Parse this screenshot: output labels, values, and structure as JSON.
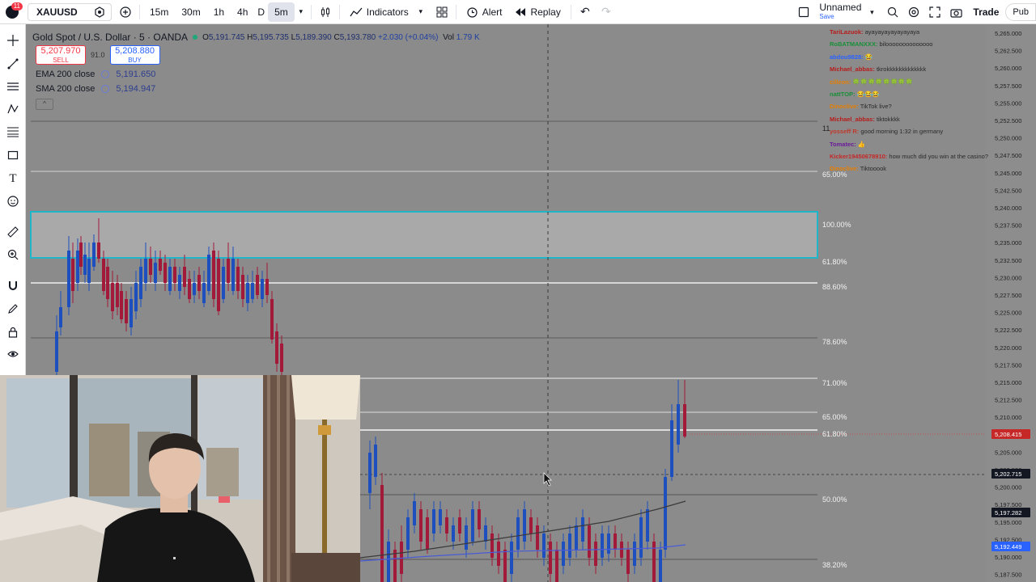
{
  "topbar": {
    "notification_count": "11",
    "symbol": "XAUUSD",
    "intervals": [
      "15m",
      "30m",
      "1h",
      "4h",
      "D",
      "5m"
    ],
    "active_interval": "5m",
    "indicators_label": "Indicators",
    "alert_label": "Alert",
    "replay_label": "Replay",
    "layout_name": "Unnamed",
    "save_label": "Save",
    "trade_label": "Trade",
    "publish_label": "Pub"
  },
  "legend": {
    "title": "Gold Spot / U.S. Dollar · 5 · OANDA",
    "open_label": "O",
    "open": "5,191.745",
    "high_label": "H",
    "high": "5,195.735",
    "low_label": "L",
    "low": "5,189.390",
    "close_label": "C",
    "close": "5,193.780",
    "change": "+2.030 (+0.04%)",
    "vol_label": "Vol",
    "vol": "1.79 K"
  },
  "trade_panel": {
    "sell_price": "5,207.970",
    "sell_label": "SELL",
    "spread": "91.0",
    "buy_price": "5,208.880",
    "buy_label": "BUY"
  },
  "indicators": [
    {
      "name": "EMA 200 close",
      "value": "5,191.650"
    },
    {
      "name": "SMA 200 close",
      "value": "5,194.947"
    }
  ],
  "collapse_icon": "^",
  "fib_levels": [
    {
      "label": "65.00%"
    },
    {
      "label": "100.00%"
    },
    {
      "label": "61.80%"
    },
    {
      "label": "88.60%"
    },
    {
      "label": "78.60%"
    },
    {
      "label": "71.00%"
    },
    {
      "label": "65.00%"
    },
    {
      "label": "61.80%"
    },
    {
      "label": "50.00%"
    },
    {
      "label": "38.20%"
    }
  ],
  "price_axis_ticks": [
    "5,265.000",
    "5,262.500",
    "5,260.000",
    "5,257.500",
    "5,255.000",
    "5,252.500",
    "5,250.000",
    "5,247.500",
    "5,245.000",
    "5,242.500",
    "5,240.000",
    "5,237.500",
    "5,235.000",
    "5,232.500",
    "5,230.000",
    "5,227.500",
    "5,225.000",
    "5,222.500",
    "5,220.000",
    "5,217.500",
    "5,215.000",
    "5,212.500",
    "5,210.000",
    "5,207.500",
    "5,205.000",
    "5,202.500",
    "5,200.000",
    "5,197.500",
    "5,195.000",
    "5,192.500",
    "5,190.000",
    "5,187.500"
  ],
  "price_badges": [
    {
      "label": "5,208.415",
      "color": "#c62828"
    },
    {
      "label": "5,202.715",
      "color": "#131722"
    },
    {
      "label": "5,197.282",
      "color": "#131722"
    },
    {
      "label": "5,192.449",
      "color": "#2962ff"
    }
  ],
  "crosshair_time_label": "11",
  "chat": [
    {
      "user": "TariLazuok:",
      "msg": "ayayayayayayayaya",
      "color": "#b71c1c"
    },
    {
      "user": "RoBATMANXXX:",
      "msg": "biloooooooooooooo",
      "color": "#1a8f3a"
    },
    {
      "user": "abdou9828:",
      "msg": "😂",
      "color": "#2962ff"
    },
    {
      "user": "Michael_abbas:",
      "msg": "tkrokkkkkkkkkkkkk",
      "color": "#b71c1c"
    },
    {
      "user": "cilleon:",
      "msg": "🍀🍀🍀🍀🍀🍀🍀🍀",
      "color": "#e67e00"
    },
    {
      "user": "nattTOP:",
      "msg": "😂😂😂",
      "color": "#1a8f3a"
    },
    {
      "user": "Dinoclive:",
      "msg": "TikTok live?",
      "color": "#e67e00"
    },
    {
      "user": "Michael_abbas:",
      "msg": "tiktokkkk",
      "color": "#b71c1c"
    },
    {
      "user": "yosseff R:",
      "msg": "good morning 1:32 in germany",
      "color": "#c0392b"
    },
    {
      "user": "Tomatec:",
      "msg": "👍",
      "color": "#6a1b9a"
    },
    {
      "user": "Kicker19450678910:",
      "msg": "how much did you win at the casino?",
      "color": "#c62828"
    },
    {
      "user": "Dinoclive:",
      "msg": "Tiktooook",
      "color": "#e67e00"
    }
  ]
}
